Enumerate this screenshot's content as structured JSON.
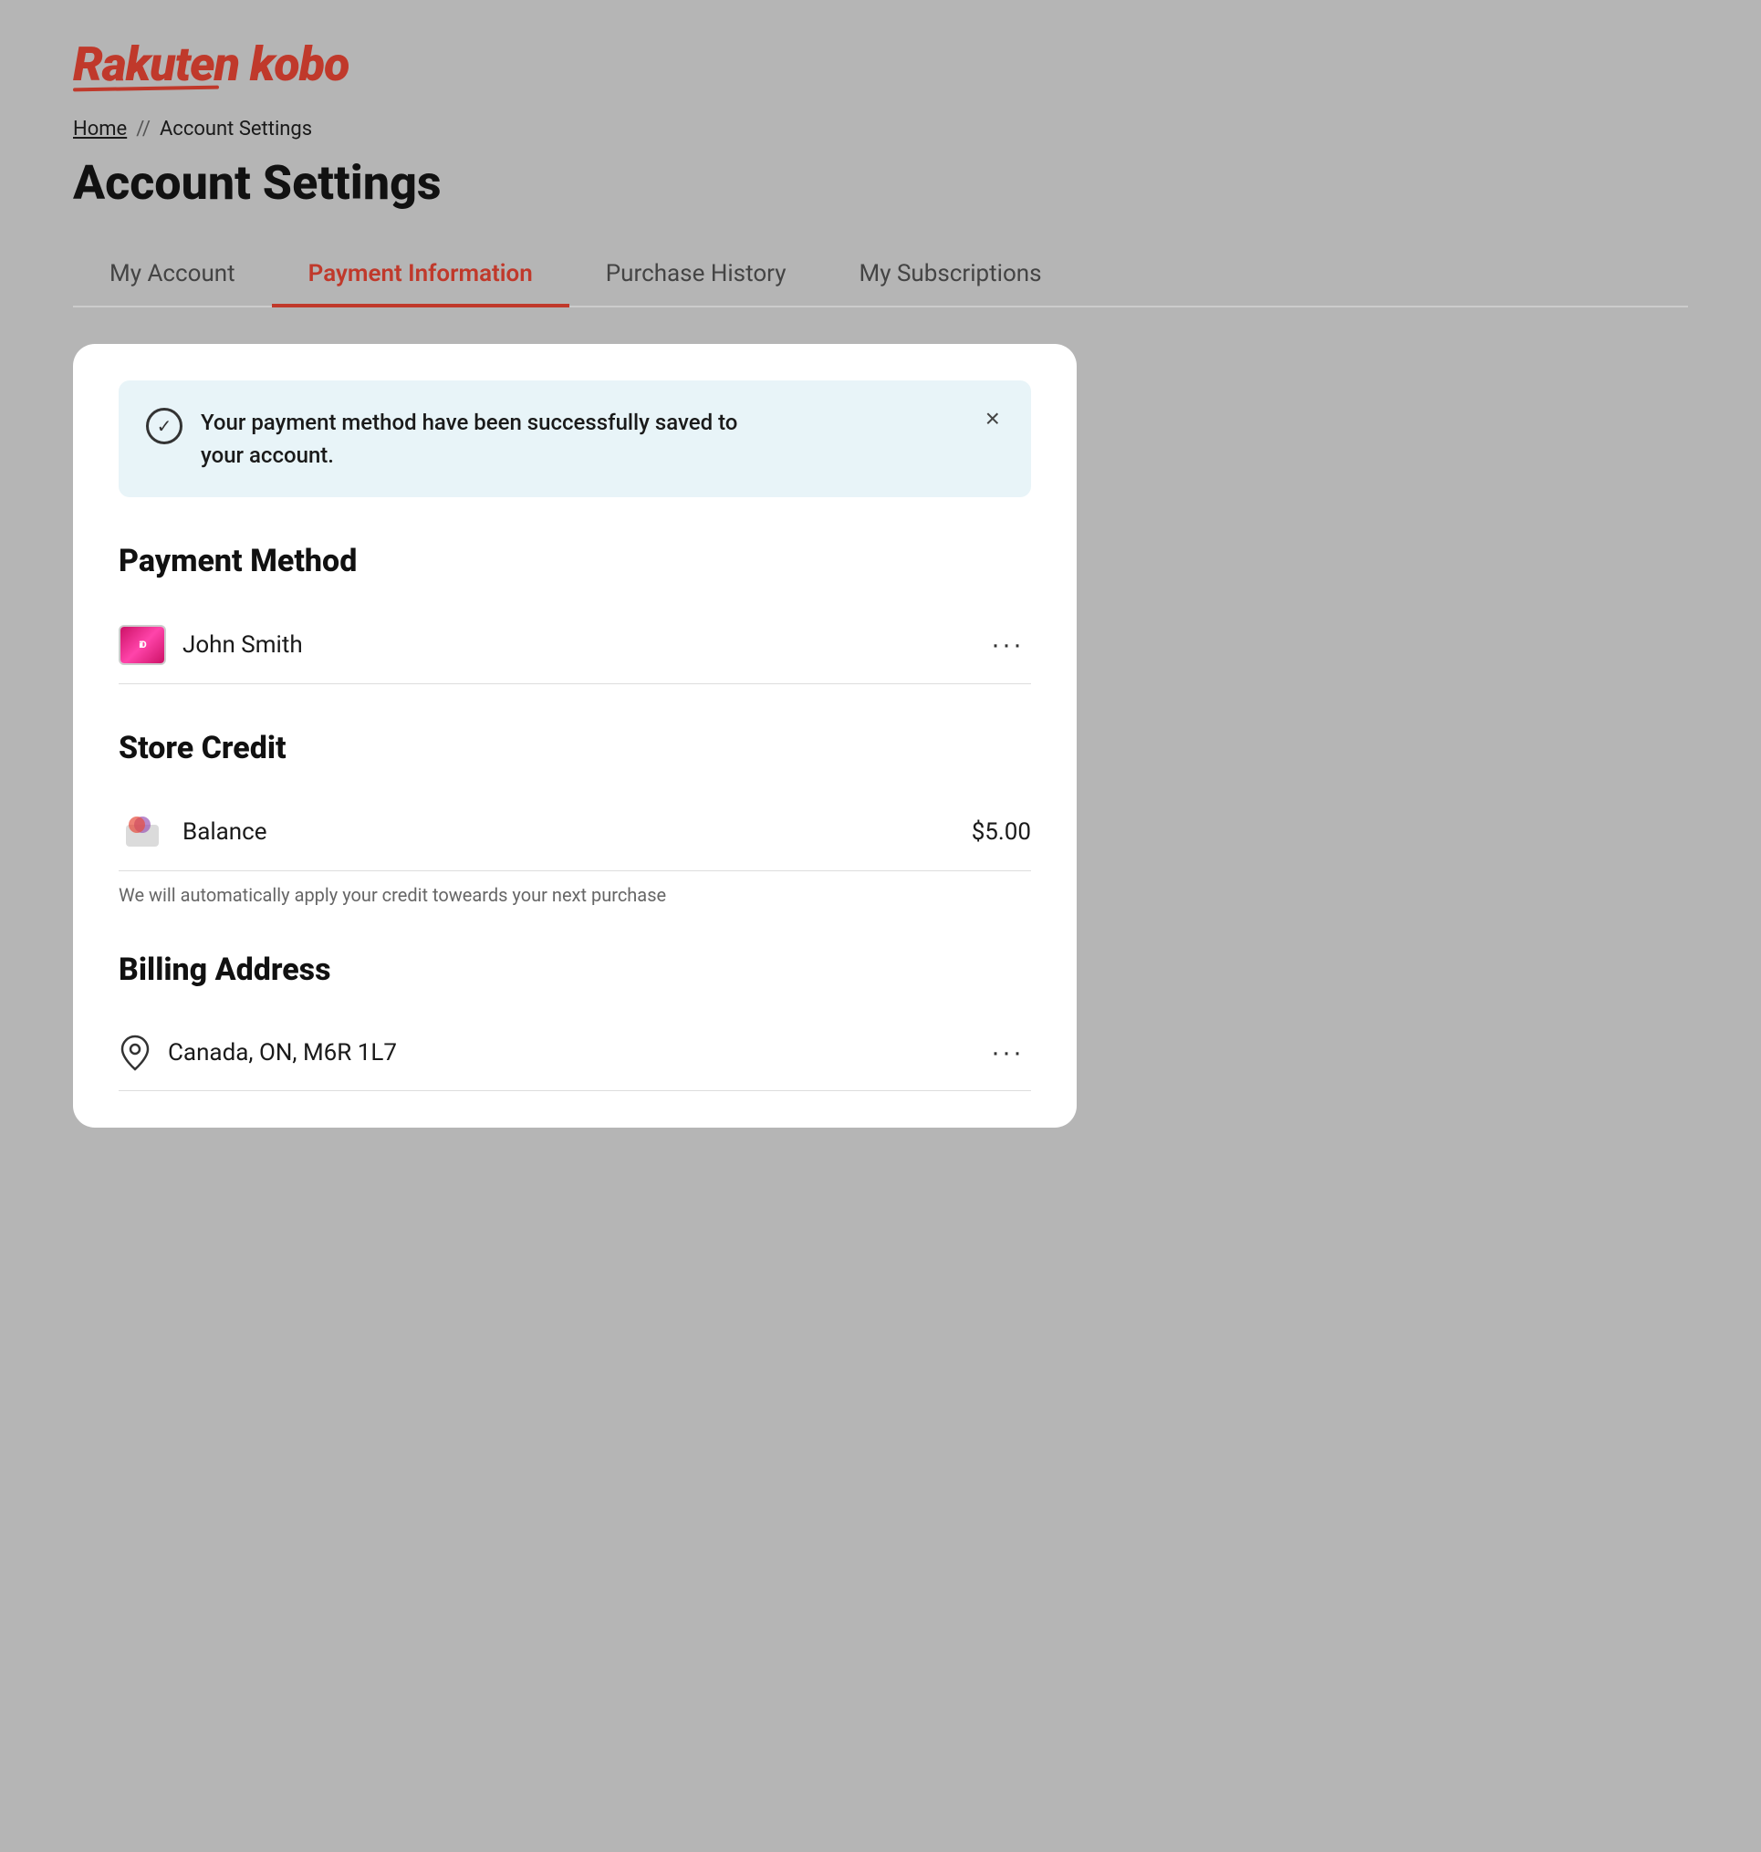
{
  "logo": {
    "text": "Rakuten kobo"
  },
  "breadcrumb": {
    "home_label": "Home",
    "separator": "//",
    "current": "Account Settings"
  },
  "page_title": "Account Settings",
  "tabs": [
    {
      "id": "my-account",
      "label": "My Account",
      "active": false
    },
    {
      "id": "payment-information",
      "label": "Payment Information",
      "active": true
    },
    {
      "id": "purchase-history",
      "label": "Purchase History",
      "active": false
    },
    {
      "id": "my-subscriptions",
      "label": "My Subscriptions",
      "active": false
    }
  ],
  "success_banner": {
    "message": "Your payment method have been successfully saved to your account.",
    "close_label": "×"
  },
  "payment_method": {
    "section_title": "Payment Method",
    "name": "John Smith",
    "icon_label": "iDEAL"
  },
  "store_credit": {
    "section_title": "Store Credit",
    "balance_label": "Balance",
    "balance_amount": "$5.00",
    "note": "We will automatically apply your credit toweards your next purchase"
  },
  "billing_address": {
    "section_title": "Billing Address",
    "address": "Canada, ON, M6R 1L7"
  }
}
